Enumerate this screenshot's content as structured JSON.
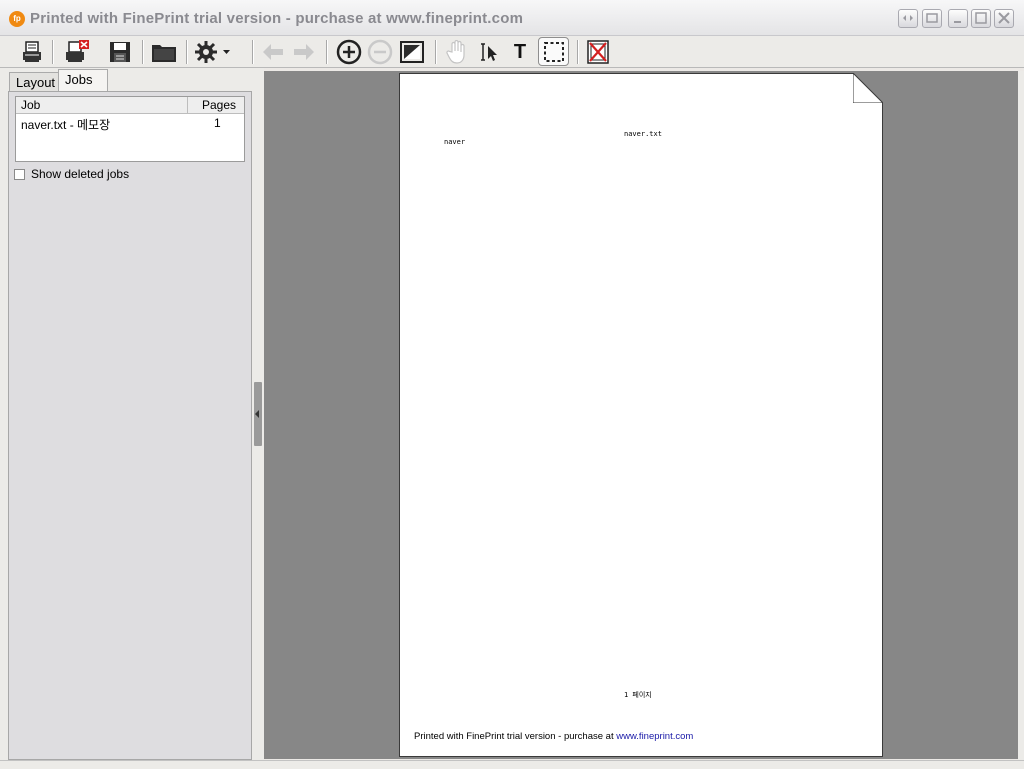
{
  "window": {
    "app_icon_text": "fp",
    "title": "Printed with FinePrint trial version - purchase at www.fineprint.com"
  },
  "icons": {
    "print": "print-icon",
    "delete_job": "delete-job-icon",
    "save": "save-icon",
    "open": "open-folder-icon",
    "settings": "gear-icon",
    "back": "arrow-left-icon",
    "forward": "arrow-right-icon",
    "zoom_in": "zoom-in-icon",
    "zoom_out": "zoom-out-icon",
    "fit_page": "fit-page-icon",
    "hand": "hand-icon",
    "select": "select-icon",
    "text": "text-tool-icon",
    "marquee": "marquee-icon",
    "delete_page": "delete-page-icon"
  },
  "toolbar": {
    "text_tool_glyph": "T"
  },
  "tabs": {
    "layout": "Layout",
    "jobs": "Jobs"
  },
  "jobs_list": {
    "col_job": "Job",
    "col_pages": "Pages",
    "rows": [
      {
        "job": "naver.txt - 메모장",
        "pages": "1"
      }
    ]
  },
  "show_deleted": {
    "label": "Show deleted jobs",
    "checked": false
  },
  "page_preview": {
    "header": "naver.txt",
    "body_line": "naver",
    "footer": "1 페이지",
    "trial_prefix": "Printed with FinePrint trial version - purchase at ",
    "trial_link": "www.fineprint.com"
  },
  "colors": {
    "accent_orange": "#f08a12",
    "preview_bg": "#878787",
    "link_blue": "#1a1aa8"
  }
}
